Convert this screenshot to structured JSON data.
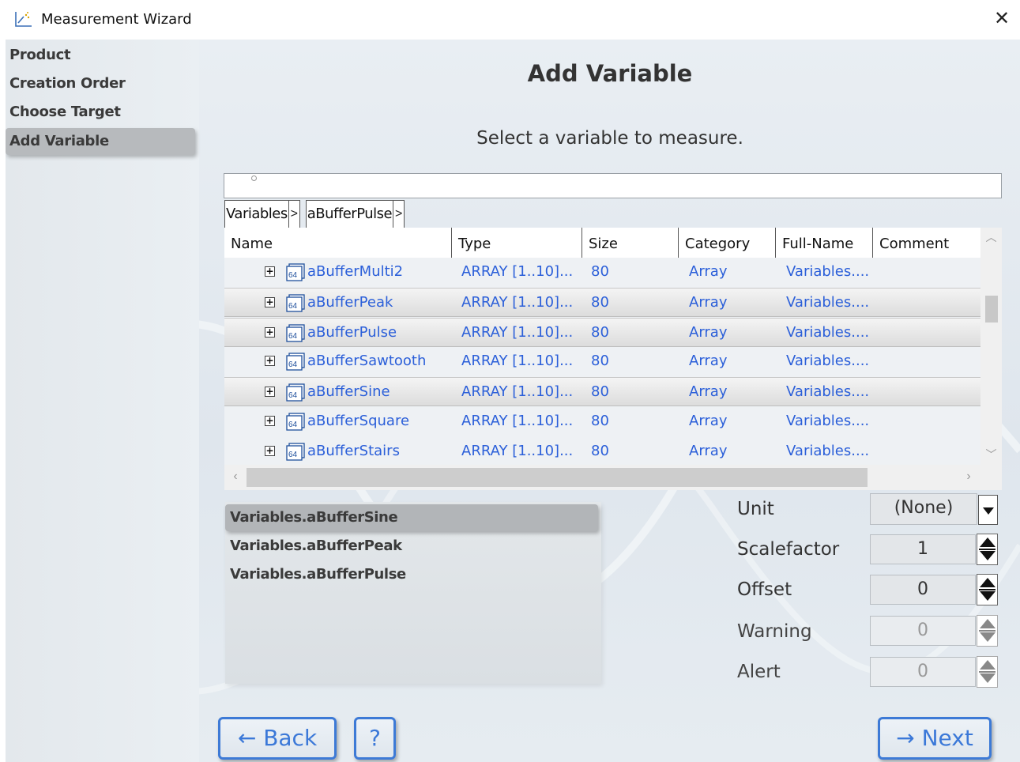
{
  "window": {
    "title": "Measurement Wizard",
    "close_glyph": "✕",
    "icon": "chart-wizard-icon"
  },
  "sidebar": {
    "items": [
      {
        "label": "Product",
        "active": false
      },
      {
        "label": "Creation Order",
        "active": false
      },
      {
        "label": "Choose Target",
        "active": false
      },
      {
        "label": "Add Variable",
        "active": true
      }
    ]
  },
  "page": {
    "heading": "Add Variable",
    "subheading": "Select a variable to measure."
  },
  "search": {
    "value": ""
  },
  "breadcrumb": {
    "items": [
      {
        "label": "Variables",
        "sep": ">"
      },
      {
        "label": "aBufferPulse",
        "sep": ">"
      }
    ]
  },
  "grid": {
    "columns": [
      "Name",
      "Type",
      "Size",
      "Category",
      "Full-Name",
      "Comment"
    ],
    "rows": [
      {
        "name": "aBufferMulti2",
        "type": "ARRAY [1..10]...",
        "size": "80",
        "category": "Array",
        "full_name": "Variables....",
        "comment": "",
        "shaded": false
      },
      {
        "name": "aBufferPeak",
        "type": "ARRAY [1..10]...",
        "size": "80",
        "category": "Array",
        "full_name": "Variables....",
        "comment": "",
        "shaded": true
      },
      {
        "name": "aBufferPulse",
        "type": "ARRAY [1..10]...",
        "size": "80",
        "category": "Array",
        "full_name": "Variables....",
        "comment": "",
        "shaded": true
      },
      {
        "name": "aBufferSawtooth",
        "type": "ARRAY [1..10]...",
        "size": "80",
        "category": "Array",
        "full_name": "Variables....",
        "comment": "",
        "shaded": false
      },
      {
        "name": "aBufferSine",
        "type": "ARRAY [1..10]...",
        "size": "80",
        "category": "Array",
        "full_name": "Variables....",
        "comment": "",
        "shaded": true
      },
      {
        "name": "aBufferSquare",
        "type": "ARRAY [1..10]...",
        "size": "80",
        "category": "Array",
        "full_name": "Variables....",
        "comment": "",
        "shaded": false
      },
      {
        "name": "aBufferStairs",
        "type": "ARRAY [1..10]...",
        "size": "80",
        "category": "Array",
        "full_name": "Variables....",
        "comment": "",
        "shaded": false
      }
    ],
    "expander_glyph": "+",
    "type_icon_label": "64"
  },
  "selected_variables": [
    {
      "label": "Variables.aBufferSine",
      "active": true
    },
    {
      "label": "Variables.aBufferPeak",
      "active": false
    },
    {
      "label": "Variables.aBufferPulse",
      "active": false
    }
  ],
  "properties": {
    "unit": {
      "label": "Unit",
      "value": "(None)"
    },
    "scalefactor": {
      "label": "Scalefactor",
      "value": "1"
    },
    "offset": {
      "label": "Offset",
      "value": "0"
    },
    "warning": {
      "label": "Warning",
      "value": "0",
      "disabled": true
    },
    "alert": {
      "label": "Alert",
      "value": "0",
      "disabled": true
    }
  },
  "buttons": {
    "back": {
      "arrow": "←",
      "label": "Back"
    },
    "help": {
      "label": "?"
    },
    "next": {
      "arrow": "→",
      "label": "Next"
    }
  },
  "colors": {
    "accent": "#3d7ad6",
    "link_text": "#2b5fd9",
    "active_nav": "#b7babd"
  }
}
